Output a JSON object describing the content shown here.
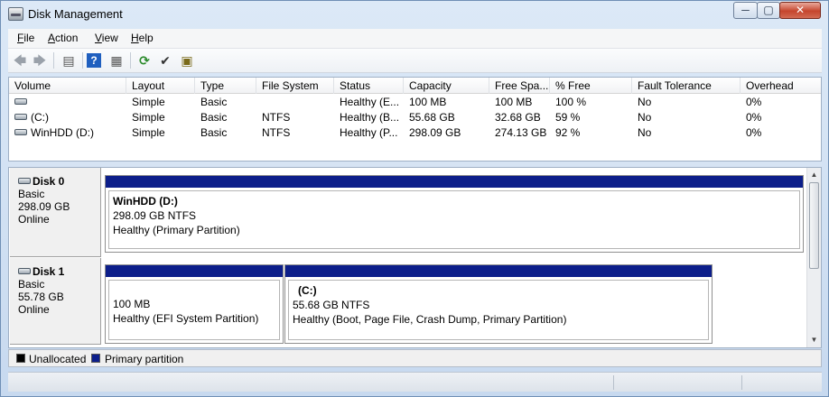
{
  "window": {
    "title": "Disk Management",
    "min_glyph": "─",
    "max_glyph": "▢",
    "close_glyph": "✕"
  },
  "menu": {
    "items": [
      {
        "accel": "F",
        "rest": "ile"
      },
      {
        "accel": "A",
        "rest": "ction"
      },
      {
        "accel": "V",
        "rest": "iew"
      },
      {
        "accel": "H",
        "rest": "elp"
      }
    ]
  },
  "toolbar": {
    "back_icon": "🡄",
    "forward_icon": "🡆",
    "list_icon": "▤",
    "help_icon": "?",
    "properties_icon": "▦",
    "refresh_icon": "⟳",
    "properties2_icon": "✔",
    "rescan_icon": "▣"
  },
  "volume_list": {
    "columns": [
      "Volume",
      "Layout",
      "Type",
      "File System",
      "Status",
      "Capacity",
      "Free Spa...",
      "% Free",
      "Fault Tolerance",
      "Overhead"
    ],
    "rows": [
      {
        "volume": "",
        "layout": "Simple",
        "type": "Basic",
        "fs": "",
        "status": "Healthy (E...",
        "capacity": "100 MB",
        "free": "100 MB",
        "pct": "100 %",
        "fault": "No",
        "overhead": "0%"
      },
      {
        "volume": "(C:)",
        "layout": "Simple",
        "type": "Basic",
        "fs": "NTFS",
        "status": "Healthy (B...",
        "capacity": "55.68 GB",
        "free": "32.68 GB",
        "pct": "59 %",
        "fault": "No",
        "overhead": "0%"
      },
      {
        "volume": "WinHDD (D:)",
        "layout": "Simple",
        "type": "Basic",
        "fs": "NTFS",
        "status": "Healthy (P...",
        "capacity": "298.09 GB",
        "free": "274.13 GB",
        "pct": "92 %",
        "fault": "No",
        "overhead": "0%"
      }
    ]
  },
  "disks": [
    {
      "name": "Disk 0",
      "type": "Basic",
      "size": "298.09 GB",
      "state": "Online",
      "partitions": [
        {
          "name": "WinHDD  (D:)",
          "size_fs": "298.09 GB NTFS",
          "status": "Healthy (Primary Partition)"
        }
      ]
    },
    {
      "name": "Disk 1",
      "type": "Basic",
      "size": "55.78 GB",
      "state": "Online",
      "partitions": [
        {
          "name": "",
          "size_fs": "100 MB",
          "status": "Healthy (EFI System Partition)"
        },
        {
          "name": "(C:)",
          "size_fs": "55.68 GB NTFS",
          "status": "Healthy (Boot, Page File, Crash Dump, Primary Partition)"
        }
      ]
    }
  ],
  "legend": {
    "unallocated": "Unallocated",
    "unallocated_color": "#000000",
    "primary": "Primary partition",
    "primary_color": "#0c1e8a"
  }
}
